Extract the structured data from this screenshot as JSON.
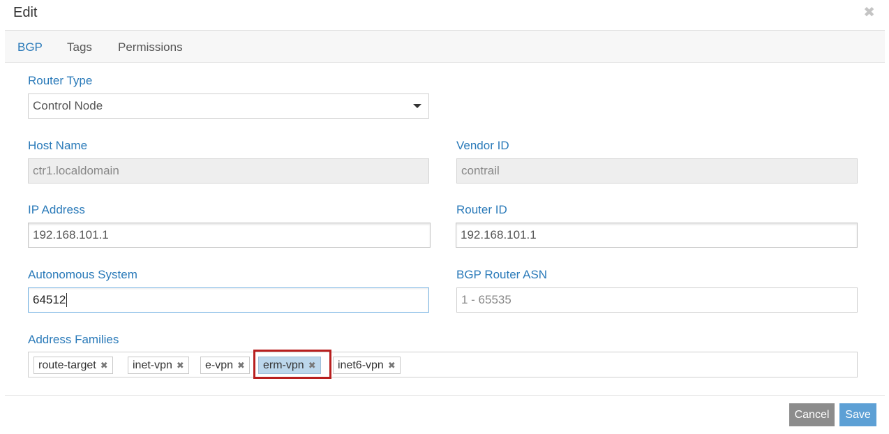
{
  "modal": {
    "title": "Edit",
    "close_icon": "close-icon",
    "tabs": [
      {
        "label": "BGP",
        "active": true
      },
      {
        "label": "Tags",
        "active": false
      },
      {
        "label": "Permissions",
        "active": false
      }
    ]
  },
  "form": {
    "router_type": {
      "label": "Router Type",
      "value": "Control Node",
      "icon": "chevron-down-icon"
    },
    "host_name": {
      "label": "Host Name",
      "value": "ctr1.localdomain"
    },
    "vendor_id": {
      "label": "Vendor ID",
      "value": "contrail"
    },
    "ip_address": {
      "label": "IP Address",
      "value": "192.168.101.1"
    },
    "router_id": {
      "label": "Router ID",
      "value": "192.168.101.1"
    },
    "autonomous_system": {
      "label": "Autonomous System",
      "value": "64512"
    },
    "bgp_router_asn": {
      "label": "BGP Router ASN",
      "placeholder": "1 - 65535"
    },
    "address_families": {
      "label": "Address Families",
      "tags": [
        {
          "label": "route-target",
          "remove_icon": "x-icon"
        },
        {
          "label": "inet-vpn",
          "remove_icon": "x-icon"
        },
        {
          "label": "e-vpn",
          "remove_icon": "x-icon"
        },
        {
          "label": "erm-vpn",
          "remove_icon": "x-icon",
          "selected": true
        },
        {
          "label": "inet6-vpn",
          "remove_icon": "x-icon"
        }
      ]
    }
  },
  "footer": {
    "cancel_label": "Cancel",
    "save_label": "Save"
  },
  "colors": {
    "accent": "#2a7ab9",
    "highlight": "#b81f1f",
    "save": "#5da0d5",
    "cancel": "#8c8c8c"
  }
}
